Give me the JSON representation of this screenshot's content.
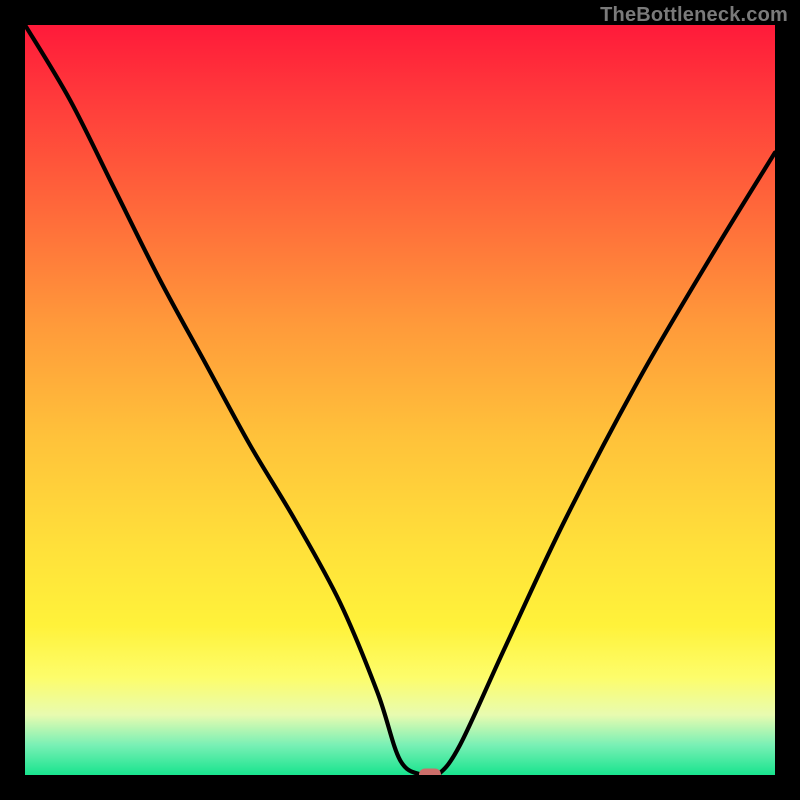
{
  "watermark": "TheBottleneck.com",
  "chart_data": {
    "type": "line",
    "title": "",
    "xlabel": "",
    "ylabel": "",
    "xlim": [
      0,
      100
    ],
    "ylim": [
      0,
      100
    ],
    "background_gradient": {
      "orientation": "vertical",
      "stops": [
        {
          "pos": 0,
          "color": "#ff1a3a"
        },
        {
          "pos": 25,
          "color": "#ff6a3a"
        },
        {
          "pos": 55,
          "color": "#ffc23a"
        },
        {
          "pos": 80,
          "color": "#fff23a"
        },
        {
          "pos": 100,
          "color": "#18e48e"
        }
      ]
    },
    "series": [
      {
        "name": "bottleneck-curve",
        "x": [
          0,
          6,
          12,
          18,
          24,
          30,
          36,
          42,
          47,
          50,
          53,
          55,
          58,
          64,
          72,
          82,
          92,
          100
        ],
        "values": [
          100,
          90,
          78,
          66,
          55,
          44,
          34,
          23,
          11,
          2,
          0,
          0,
          4,
          17,
          34,
          53,
          70,
          83
        ]
      }
    ],
    "marker": {
      "x": 54,
      "y": 0,
      "color": "#cc6e6a"
    }
  }
}
